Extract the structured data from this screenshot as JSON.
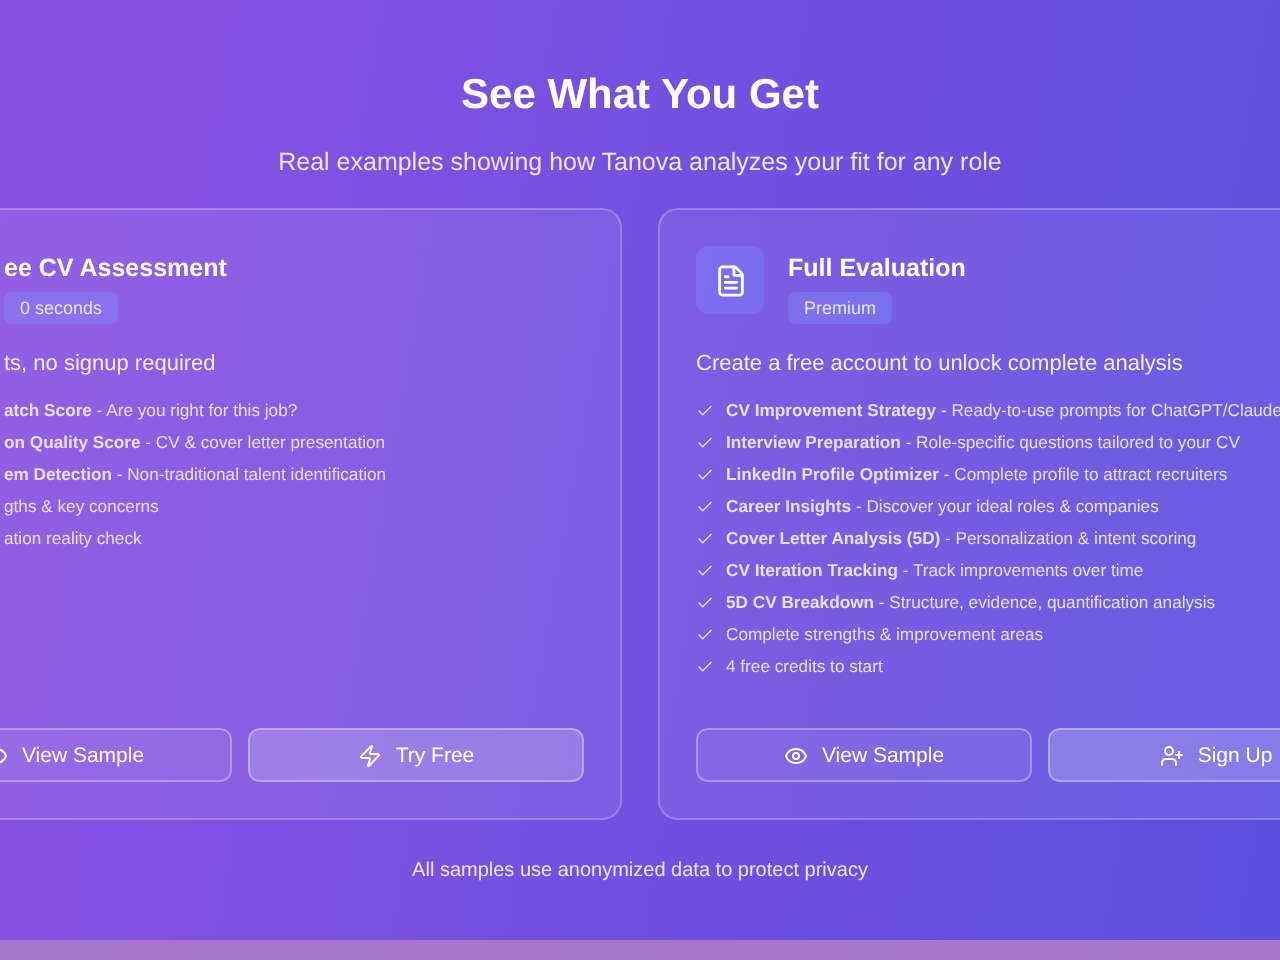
{
  "heading": "See What You Get",
  "subheading": "Real examples showing how Tanova analyzes your fit for any role",
  "cards": [
    {
      "kind": "cropped",
      "title": "ee CV Assessment",
      "badge": "0 seconds",
      "intro": "ts, no signup required",
      "features": [
        "**atch Score** - Are you right for this job?",
        "**on Quality Score** - CV & cover letter presentation",
        "**em Detection** - Non-traditional talent identification",
        "gths & key concerns",
        "ation reality check"
      ],
      "buttons": [
        {
          "label": "View Sample",
          "kind": "view",
          "primary": false
        },
        {
          "label": "Try Free",
          "kind": "try",
          "primary": true
        }
      ]
    },
    {
      "kind": "full",
      "title": "Full Evaluation",
      "badge": "Premium",
      "intro": "Create a free account to unlock complete analysis",
      "features": [
        "**CV Improvement Strategy** - Ready-to-use prompts for ChatGPT/Claude",
        "**Interview Preparation** - Role-specific questions tailored to your CV",
        "**LinkedIn Profile Optimizer** - Complete profile to attract recruiters",
        "**Career Insights** - Discover your ideal roles & companies",
        "**Cover Letter Analysis (5D)** - Personalization & intent scoring",
        "**CV Iteration Tracking** - Track improvements over time",
        "**5D CV Breakdown** - Structure, evidence, quantification analysis",
        "Complete strengths & improvement areas",
        "4 free credits to start"
      ],
      "buttons": [
        {
          "label": "View Sample",
          "kind": "view",
          "primary": false
        },
        {
          "label": "Sign Up",
          "kind": "signup",
          "primary": true
        }
      ]
    }
  ],
  "footnote": "All samples use anonymized data to protect privacy"
}
